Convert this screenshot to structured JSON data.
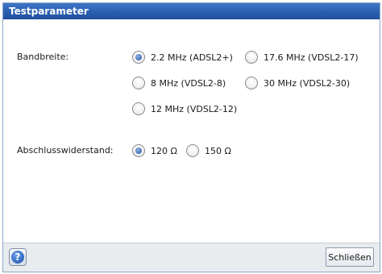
{
  "dialog": {
    "title": "Testparameter"
  },
  "bandwidth": {
    "label": "Bandbreite:",
    "options": [
      {
        "label": "2.2 MHz (ADSL2+)",
        "checked": true
      },
      {
        "label": "17.6 MHz (VDSL2-17)",
        "checked": false
      },
      {
        "label": "8 MHz (VDSL2-8)",
        "checked": false
      },
      {
        "label": "30 MHz (VDSL2-30)",
        "checked": false
      },
      {
        "label": "12 MHz (VDSL2-12)",
        "checked": false
      }
    ]
  },
  "termination": {
    "label": "Abschlusswiderstand:",
    "options": [
      {
        "label": "120 Ω",
        "checked": true
      },
      {
        "label": "150 Ω",
        "checked": false
      }
    ]
  },
  "footer": {
    "help_icon": "help-icon",
    "close_label": "Schließen"
  },
  "colors": {
    "title_bar": "#2a5fb0",
    "radio_selected": "#3f6fb3",
    "footer_bg": "#e9ecef"
  }
}
